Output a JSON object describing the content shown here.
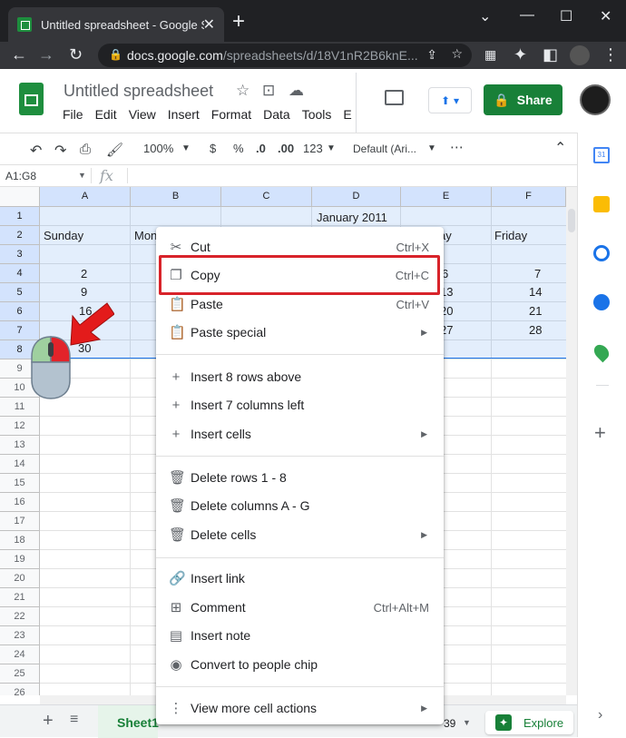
{
  "browser": {
    "tab_title": "Untitled spreadsheet - Google Sh",
    "url_main": "docs.google.com",
    "url_path": "/spreadsheets/d/18V1nR2B6knE..."
  },
  "app": {
    "title": "Untitled spreadsheet",
    "menus": [
      "File",
      "Edit",
      "View",
      "Insert",
      "Format",
      "Data",
      "Tools",
      "E"
    ],
    "share_label": "Share"
  },
  "toolbar": {
    "zoom": "100%",
    "currency": "$",
    "percent": "%",
    "dec_less": ".0",
    "dec_more": ".00",
    "format_num": "123",
    "font": "Default (Ari..."
  },
  "formula": {
    "namebox": "A1:G8",
    "fx": "fx"
  },
  "grid": {
    "columns": [
      "A",
      "B",
      "C",
      "D",
      "E",
      "F"
    ],
    "rows": [
      "1",
      "2",
      "3",
      "4",
      "5",
      "6",
      "7",
      "8",
      "9",
      "10",
      "11",
      "12",
      "13",
      "14",
      "15",
      "16",
      "17",
      "18",
      "19",
      "20",
      "21",
      "22",
      "23",
      "24",
      "25",
      "26"
    ],
    "month_title": "January 2011",
    "cells": {
      "a2": "Sunday",
      "b2": "Mon",
      "e2": "ay",
      "f2": "Friday",
      "a4": "2",
      "a5": "9",
      "a6": "16",
      "a8": "30",
      "e4": "6",
      "e5": "13",
      "e6": "20",
      "e7": "27",
      "f4": "7",
      "f5": "14",
      "f6": "21",
      "f7": "28"
    }
  },
  "context_menu": {
    "cut": {
      "label": "Cut",
      "shortcut": "Ctrl+X"
    },
    "copy": {
      "label": "Copy",
      "shortcut": "Ctrl+C"
    },
    "paste": {
      "label": "Paste",
      "shortcut": "Ctrl+V"
    },
    "paste_special": {
      "label": "Paste special"
    },
    "insert_rows": {
      "label": "Insert 8 rows above"
    },
    "insert_cols": {
      "label": "Insert 7 columns left"
    },
    "insert_cells": {
      "label": "Insert cells"
    },
    "delete_rows": {
      "label": "Delete rows 1 - 8"
    },
    "delete_cols": {
      "label": "Delete columns A - G"
    },
    "delete_cells": {
      "label": "Delete cells"
    },
    "insert_link": {
      "label": "Insert link"
    },
    "comment": {
      "label": "Comment",
      "shortcut": "Ctrl+Alt+M"
    },
    "insert_note": {
      "label": "Insert note"
    },
    "people_chip": {
      "label": "Convert to people chip"
    },
    "more_actions": {
      "label": "View more cell actions"
    }
  },
  "bottom": {
    "sheet_tab": "Sheet1",
    "sum_fragment": "39",
    "explore": "Explore"
  },
  "colors": {
    "green": "#188038",
    "highlight": "#d8232a",
    "selection": "#d3e3fd"
  }
}
